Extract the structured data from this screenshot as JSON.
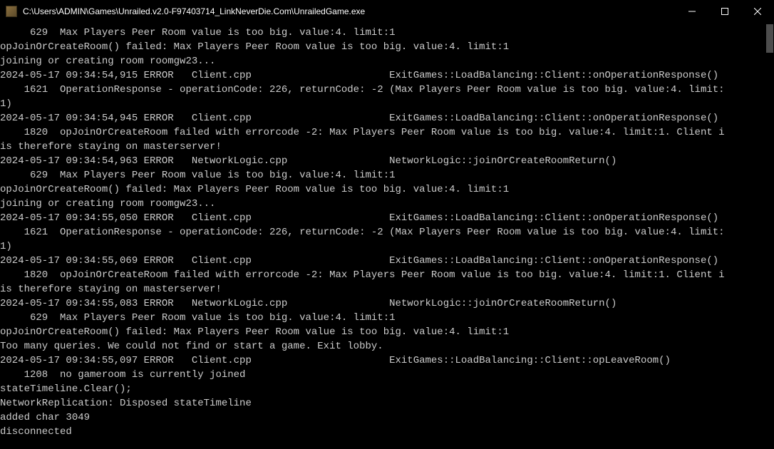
{
  "window": {
    "title": "C:\\Users\\ADMIN\\Games\\Unrailed.v2.0-F97403714_LinkNeverDie.Com\\UnrailedGame.exe"
  },
  "console": {
    "lines": [
      "     629  Max Players Peer Room value is too big. value:4. limit:1",
      "opJoinOrCreateRoom() failed: Max Players Peer Room value is too big. value:4. limit:1",
      "joining or creating room roomgw23...",
      "2024-05-17 09:34:54,915 ERROR   Client.cpp                       ExitGames::LoadBalancing::Client::onOperationResponse()",
      "    1621  OperationResponse - operationCode: 226, returnCode: -2 (Max Players Peer Room value is too big. value:4. limit:",
      "1)",
      "2024-05-17 09:34:54,945 ERROR   Client.cpp                       ExitGames::LoadBalancing::Client::onOperationResponse()",
      "    1820  opJoinOrCreateRoom failed with errorcode -2: Max Players Peer Room value is too big. value:4. limit:1. Client i",
      "is therefore staying on masterserver!",
      "2024-05-17 09:34:54,963 ERROR   NetworkLogic.cpp                 NetworkLogic::joinOrCreateRoomReturn()",
      "     629  Max Players Peer Room value is too big. value:4. limit:1",
      "opJoinOrCreateRoom() failed: Max Players Peer Room value is too big. value:4. limit:1",
      "joining or creating room roomgw23...",
      "2024-05-17 09:34:55,050 ERROR   Client.cpp                       ExitGames::LoadBalancing::Client::onOperationResponse()",
      "    1621  OperationResponse - operationCode: 226, returnCode: -2 (Max Players Peer Room value is too big. value:4. limit:",
      "1)",
      "2024-05-17 09:34:55,069 ERROR   Client.cpp                       ExitGames::LoadBalancing::Client::onOperationResponse()",
      "    1820  opJoinOrCreateRoom failed with errorcode -2: Max Players Peer Room value is too big. value:4. limit:1. Client i",
      "is therefore staying on masterserver!",
      "2024-05-17 09:34:55,083 ERROR   NetworkLogic.cpp                 NetworkLogic::joinOrCreateRoomReturn()",
      "     629  Max Players Peer Room value is too big. value:4. limit:1",
      "opJoinOrCreateRoom() failed: Max Players Peer Room value is too big. value:4. limit:1",
      "Too many queries. We could not find or start a game. Exit lobby.",
      "2024-05-17 09:34:55,097 ERROR   Client.cpp                       ExitGames::LoadBalancing::Client::opLeaveRoom()",
      "    1208  no gameroom is currently joined",
      "stateTimeline.Clear();",
      "NetworkReplication: Disposed stateTimeline",
      "added char 3049",
      "disconnected"
    ]
  }
}
